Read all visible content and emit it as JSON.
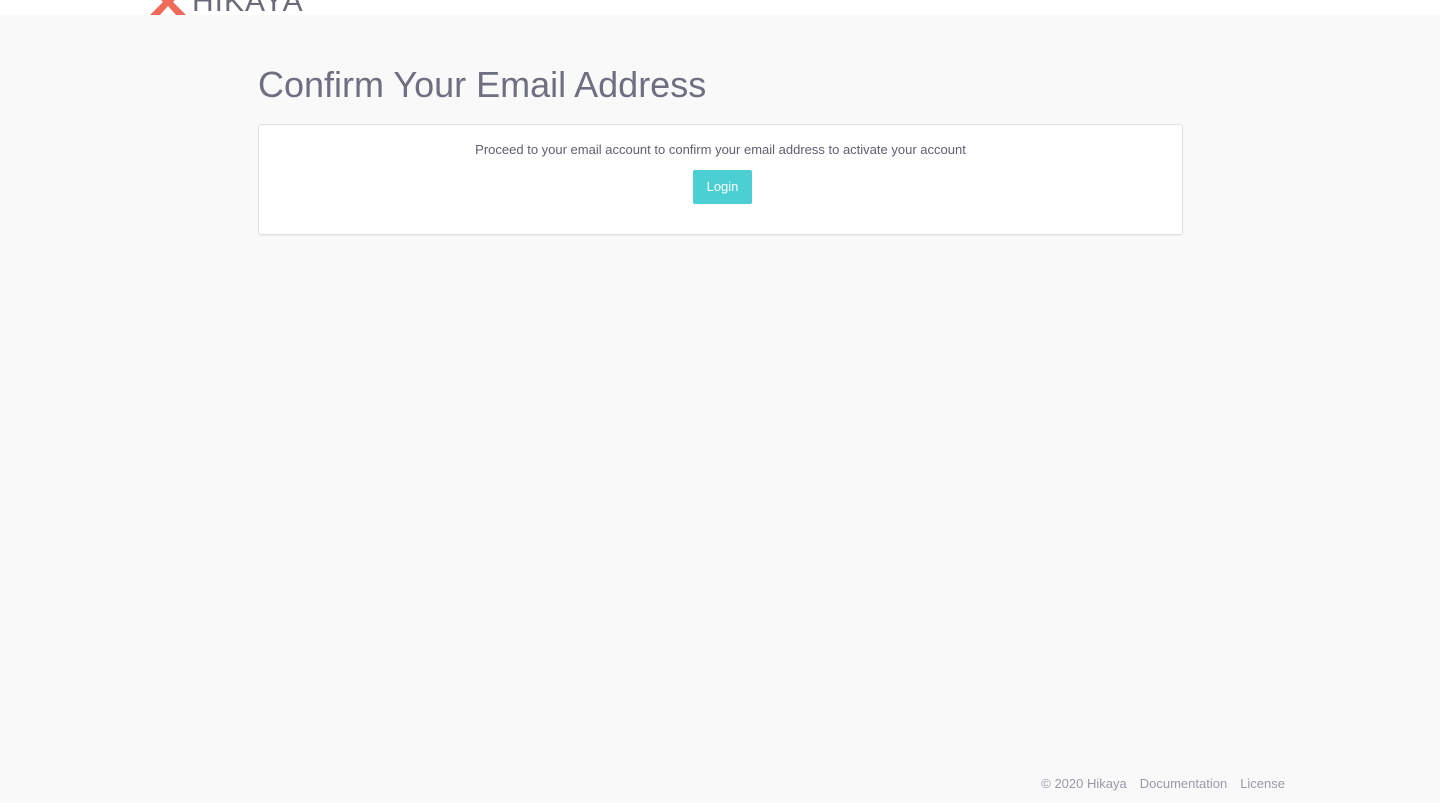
{
  "header": {
    "logo_text": "HIKAYA"
  },
  "page": {
    "title": "Confirm Your Email Address"
  },
  "card": {
    "message": "Proceed to your email account to confirm your email address to activate your account",
    "login_label": "Login"
  },
  "footer": {
    "copyright": "© 2020 Hikaya",
    "documentation_label": "Documentation",
    "license_label": "License"
  },
  "colors": {
    "accent": "#4ccfd3",
    "brand": "#f06a5a",
    "background": "#f9f9f9"
  }
}
